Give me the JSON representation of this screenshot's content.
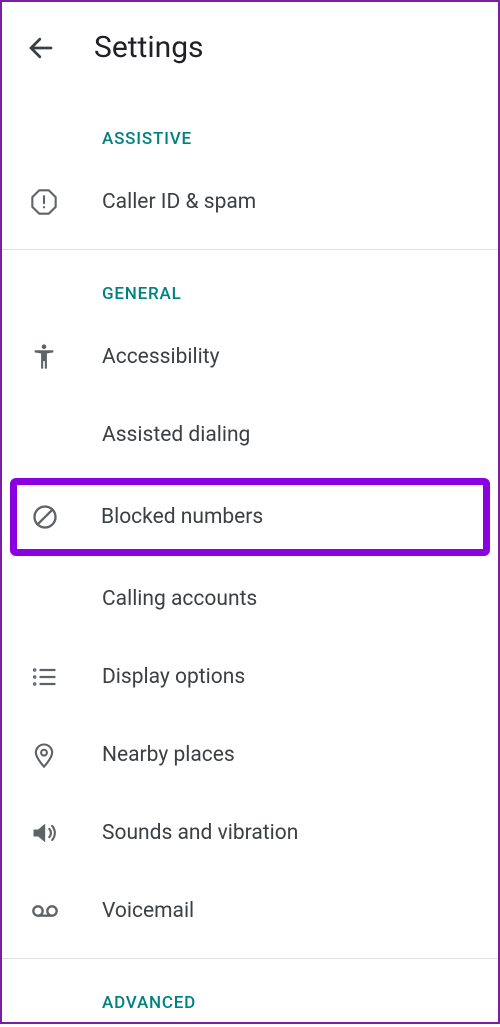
{
  "header": {
    "title": "Settings"
  },
  "sections": {
    "assistive": {
      "header": "ASSISTIVE",
      "caller_id": "Caller ID & spam"
    },
    "general": {
      "header": "GENERAL",
      "accessibility": "Accessibility",
      "assisted_dialing": "Assisted dialing",
      "blocked_numbers": "Blocked numbers",
      "calling_accounts": "Calling accounts",
      "display_options": "Display options",
      "nearby_places": "Nearby places",
      "sounds_vibration": "Sounds and vibration",
      "voicemail": "Voicemail"
    },
    "advanced": {
      "header": "ADVANCED"
    }
  }
}
